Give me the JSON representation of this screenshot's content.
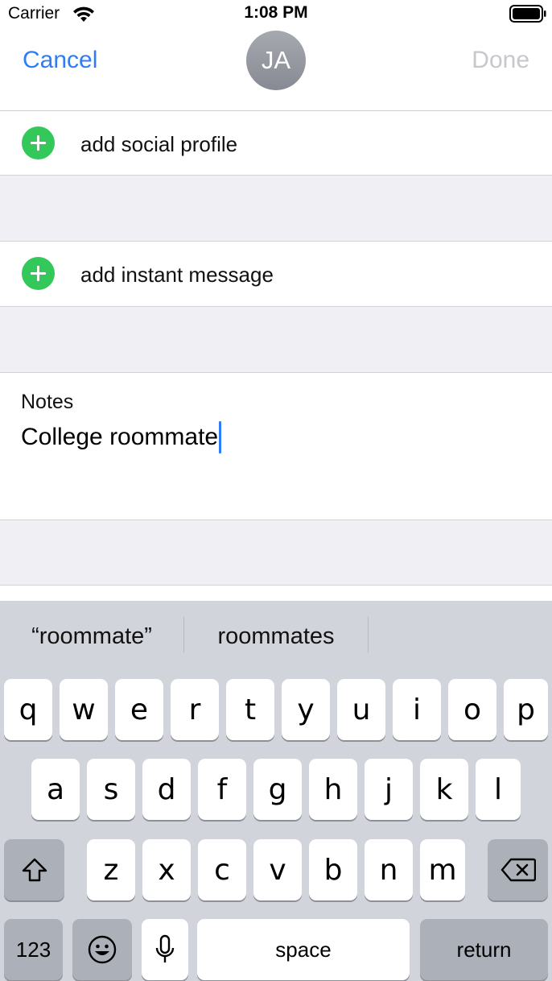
{
  "status_bar": {
    "carrier": "Carrier",
    "time": "1:08 PM"
  },
  "nav": {
    "cancel_label": "Cancel",
    "avatar_initials": "JA",
    "done_label": "Done"
  },
  "rows": {
    "add_social_profile": "add social profile",
    "add_instant_message": "add instant message"
  },
  "notes": {
    "label": "Notes",
    "value": "College roommate"
  },
  "keyboard": {
    "suggestions": [
      "“roommate”",
      "roommates"
    ],
    "row1": [
      "q",
      "w",
      "e",
      "r",
      "t",
      "y",
      "u",
      "i",
      "o",
      "p"
    ],
    "row2": [
      "a",
      "s",
      "d",
      "f",
      "g",
      "h",
      "j",
      "k",
      "l"
    ],
    "row3": [
      "z",
      "x",
      "c",
      "v",
      "b",
      "n",
      "m"
    ],
    "numbers_label": "123",
    "space_label": "space",
    "return_label": "return"
  },
  "colors": {
    "accent": "#2f7df6",
    "add_green": "#34c759",
    "done_disabled": "#c7c7cc"
  },
  "icons": {
    "wifi": "wifi-icon",
    "battery": "battery-icon",
    "add": "add-circle-icon",
    "shift": "shift-icon",
    "backspace": "backspace-icon",
    "emoji": "emoji-icon",
    "mic": "microphone-icon"
  }
}
